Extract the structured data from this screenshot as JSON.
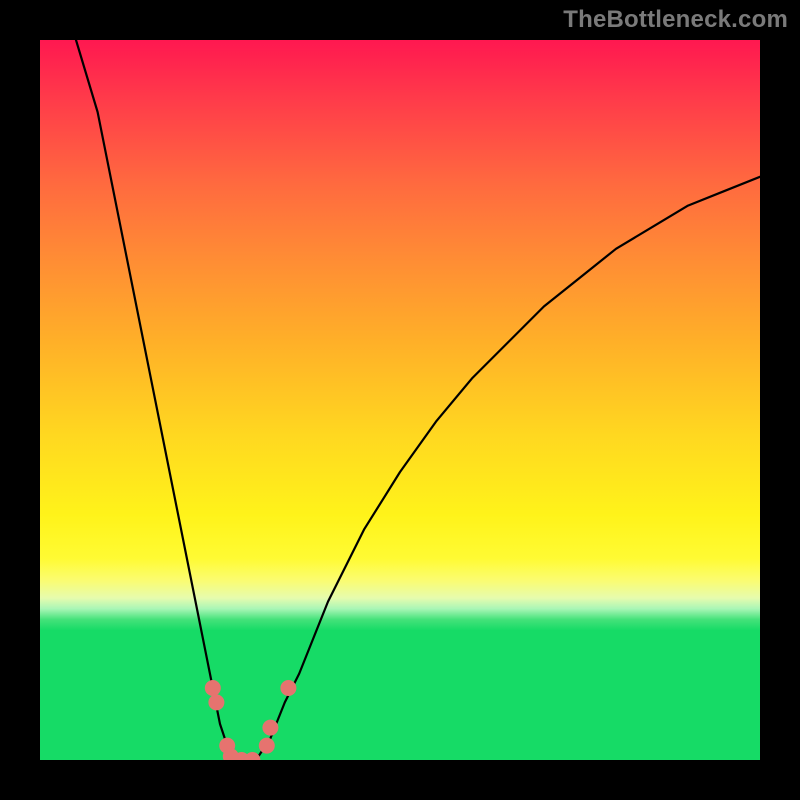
{
  "watermark": "TheBottleneck.com",
  "chart_data": {
    "type": "line",
    "title": "",
    "xlabel": "",
    "ylabel": "",
    "xlim": [
      0,
      100
    ],
    "ylim": [
      0,
      100
    ],
    "grid": false,
    "legend": false,
    "series": [
      {
        "name": "left-curve",
        "x": [
          5,
          8,
          10,
          12,
          14,
          16,
          18,
          20,
          22,
          24,
          25,
          26,
          27,
          28
        ],
        "y": [
          100,
          90,
          80,
          70,
          60,
          50,
          40,
          30,
          20,
          10,
          5,
          2,
          0,
          0
        ]
      },
      {
        "name": "right-curve",
        "x": [
          30,
          32,
          34,
          36,
          38,
          40,
          45,
          50,
          55,
          60,
          65,
          70,
          75,
          80,
          85,
          90,
          95,
          100
        ],
        "y": [
          0,
          3,
          8,
          12,
          17,
          22,
          32,
          40,
          47,
          53,
          58,
          63,
          67,
          71,
          74,
          77,
          79,
          81
        ]
      }
    ],
    "markers": [
      {
        "x": 24.0,
        "y": 10.0
      },
      {
        "x": 24.5,
        "y": 8.0
      },
      {
        "x": 26.0,
        "y": 2.0
      },
      {
        "x": 26.5,
        "y": 0.5
      },
      {
        "x": 28.0,
        "y": 0.0
      },
      {
        "x": 29.5,
        "y": 0.0
      },
      {
        "x": 31.5,
        "y": 2.0
      },
      {
        "x": 32.0,
        "y": 4.5
      },
      {
        "x": 34.5,
        "y": 10.0
      }
    ],
    "colors": {
      "curve_stroke": "#000000",
      "marker_fill": "#e6736f",
      "gradient_top": "#ff1850",
      "gradient_mid": "#fff31a",
      "gradient_bottom": "#16db66"
    }
  }
}
